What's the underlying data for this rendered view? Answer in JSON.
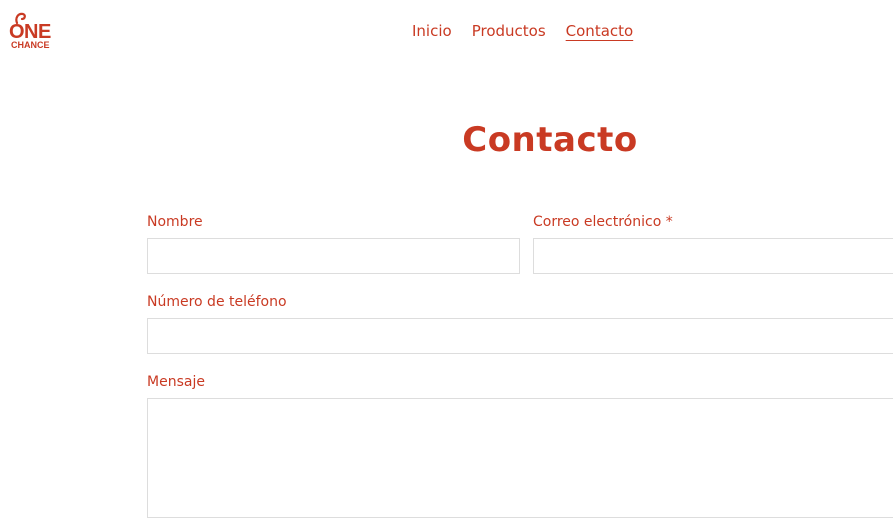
{
  "brand": {
    "line1": "ONE",
    "line2": "CHANCE",
    "color": "#c93a23"
  },
  "nav": {
    "items": [
      {
        "label": "Inicio"
      },
      {
        "label": "Productos"
      },
      {
        "label": "Contacto"
      }
    ],
    "active": "Contacto"
  },
  "page": {
    "title": "Contacto"
  },
  "form": {
    "name_label": "Nombre",
    "name_value": "",
    "email_label": "Correo electrónico *",
    "email_value": "",
    "phone_label": "Número de teléfono",
    "phone_value": "",
    "message_label": "Mensaje",
    "message_value": ""
  }
}
